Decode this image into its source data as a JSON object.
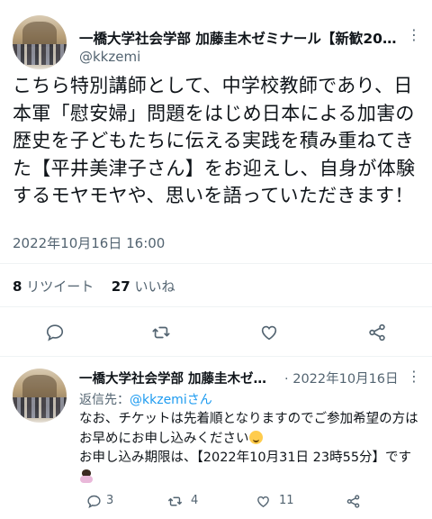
{
  "tweet": {
    "author_name": "一橋大学社会学部 加藤圭木ゼミナール【新歓20…",
    "handle": "@kkzemi",
    "text": "こちら特別講師として、中学校教師であり、日本軍「慰安婦」問題をはじめ日本による加害の歴史を子どもたちに伝える実践を積み重ねてきた【平井美津子さん】をお迎えし、自身が体験するモヤモヤや、思いを語っていただきます！",
    "timestamp": "2022年10月16日 16:00",
    "retweets_count": "8",
    "retweets_label": "リツイート",
    "likes_count": "27",
    "likes_label": "いいね",
    "more_icon": "⋮"
  },
  "reply": {
    "author_name": "一橋大学社会学部 加藤圭木ゼ…",
    "date": "· 2022年10月16日",
    "reply_to_label": "返信先：",
    "reply_to_handle": "@kkzemiさん",
    "text_line1": "なお、チケットは先着順となりますのでご参加希望の方はお早めにお申し込みください",
    "text_line2": "お申し込み期限は、【2022年10月31日 23時55分】です",
    "reply_count": "3",
    "retweet_count": "4",
    "like_count": "11",
    "more_icon": "⋮"
  },
  "colors": {
    "text": "#0f1419",
    "secondary": "#536471",
    "link": "#1d9bf0",
    "divider": "#eff3f4"
  }
}
